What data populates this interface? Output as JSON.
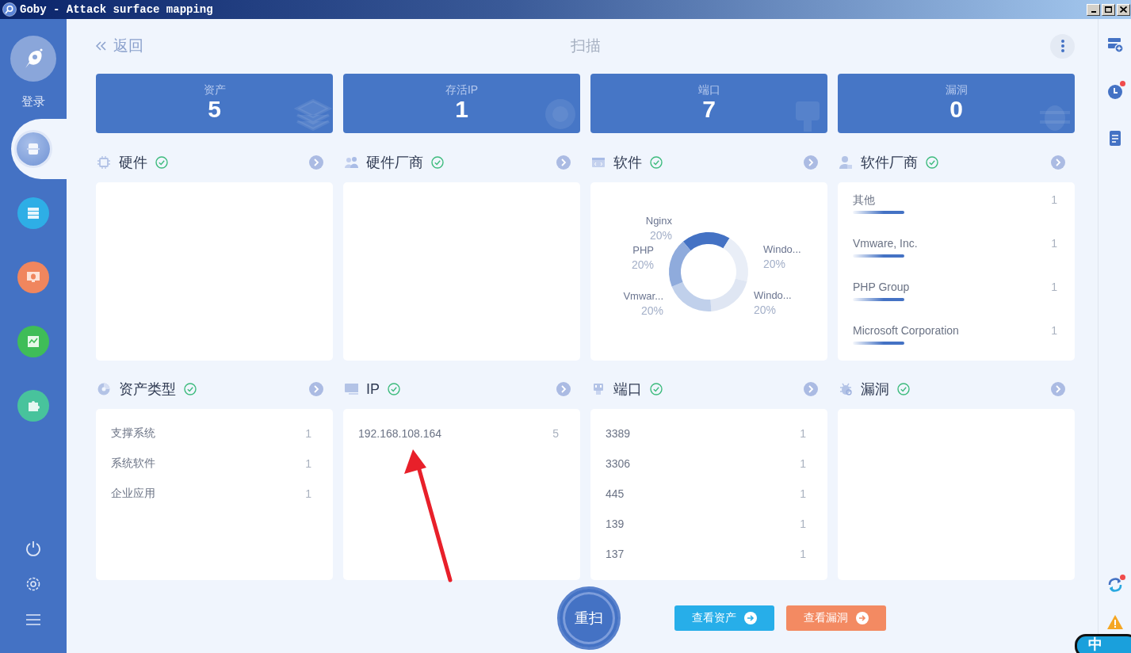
{
  "window": {
    "title": "Goby - Attack surface mapping"
  },
  "sidebar": {
    "login_label": "登录",
    "nav_items": [
      {
        "kind": "scan",
        "selected": true
      },
      {
        "kind": "assets",
        "selected": false
      },
      {
        "kind": "vulns",
        "selected": false
      },
      {
        "kind": "stats",
        "selected": false
      },
      {
        "kind": "plugins",
        "selected": false
      }
    ]
  },
  "header": {
    "back_label": "返回",
    "title": "扫描"
  },
  "stats": [
    {
      "kind": "assets",
      "label": "资产",
      "value": "5"
    },
    {
      "kind": "ip",
      "label": "存活IP",
      "value": "1"
    },
    {
      "kind": "port",
      "label": "端口",
      "value": "7"
    },
    {
      "kind": "vuln",
      "label": "漏洞",
      "value": "0"
    }
  ],
  "panels": [
    {
      "kind": "empty",
      "title": "硬件",
      "complete": true
    },
    {
      "kind": "empty",
      "title": "硬件厂商",
      "complete": true
    },
    {
      "kind": "chart",
      "title": "软件",
      "complete": true,
      "chart_data": {
        "type": "donut",
        "categories": [
          "Nginx",
          "Windo...",
          "Windo...",
          "Vmwar...",
          "PHP"
        ],
        "values": [
          20,
          20,
          20,
          20,
          20
        ],
        "value_labels": [
          "20%",
          "20%",
          "20%",
          "20%",
          "20%"
        ]
      }
    },
    {
      "kind": "bars",
      "title": "软件厂商",
      "complete": true,
      "rows": [
        {
          "label": "其他",
          "count": "1"
        },
        {
          "label": "Vmware, Inc.",
          "count": "1"
        },
        {
          "label": "PHP Group",
          "count": "1"
        },
        {
          "label": "Microsoft Corporation",
          "count": "1"
        }
      ]
    },
    {
      "kind": "list",
      "title": "资产类型",
      "complete": true,
      "rows": [
        {
          "label": "支撑系统",
          "count": "1"
        },
        {
          "label": "系统软件",
          "count": "1"
        },
        {
          "label": "企业应用",
          "count": "1"
        }
      ]
    },
    {
      "kind": "list",
      "title": "IP",
      "complete": true,
      "rows": [
        {
          "label": "192.168.108.164",
          "count": "5"
        }
      ]
    },
    {
      "kind": "list",
      "title": "端口",
      "complete": true,
      "rows": [
        {
          "label": "3389",
          "count": "1"
        },
        {
          "label": "3306",
          "count": "1"
        },
        {
          "label": "445",
          "count": "1"
        },
        {
          "label": "139",
          "count": "1"
        },
        {
          "label": "137",
          "count": "1"
        }
      ]
    },
    {
      "kind": "empty",
      "title": "漏洞",
      "complete": true
    }
  ],
  "rescan": "重扫",
  "actions": [
    {
      "kind": "primary",
      "label": "查看资产"
    },
    {
      "kind": "warning",
      "label": "查看漏洞"
    }
  ],
  "right_tools": [
    {
      "kind": "add-task",
      "badge": false
    },
    {
      "kind": "history",
      "badge": true
    },
    {
      "kind": "report",
      "badge": false
    },
    {
      "kind": "update",
      "badge": true
    },
    {
      "kind": "warning",
      "badge": false
    }
  ],
  "ime": {
    "label": "中"
  }
}
